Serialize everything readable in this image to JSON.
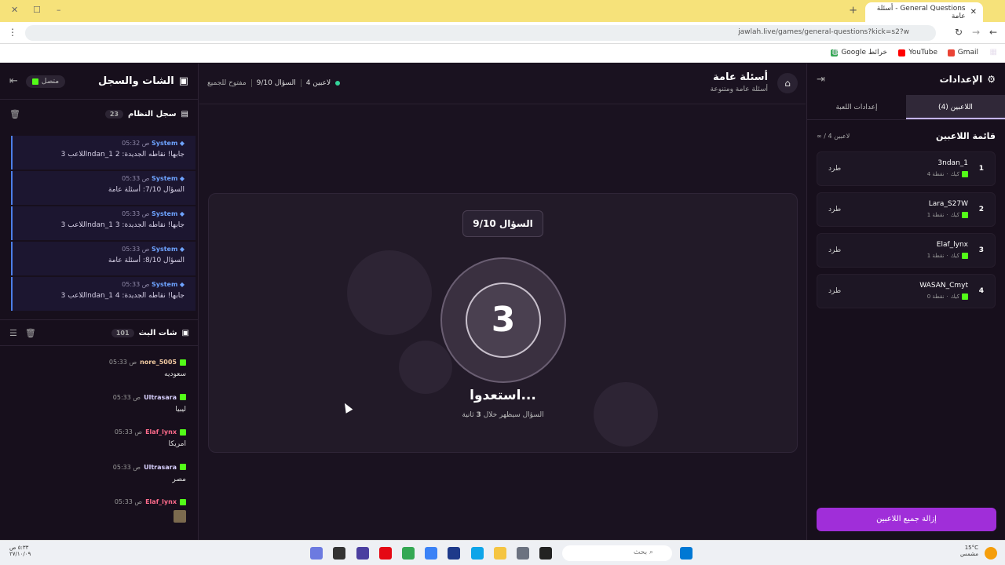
{
  "browser": {
    "tab_title": "General Questions - أسئلة عامة",
    "url": "jawlah.live/games/general-questions?kick=s2?w",
    "bookmarks": [
      "Gmail",
      "YouTube",
      "Google خرائط"
    ]
  },
  "chat_panel": {
    "title": "الشات والسجل",
    "online_label": "متصل",
    "system_log": {
      "title": "سجل النظام",
      "count": "23",
      "entries": [
        {
          "author": "System",
          "time": "05:32 ص",
          "msg": "اللاعب 3ndan_1 جابها! نقاطه الجديدة: 2"
        },
        {
          "author": "System",
          "time": "05:33 ص",
          "msg": "السؤال 7/10: أسئلة عامة"
        },
        {
          "author": "System",
          "time": "05:33 ص",
          "msg": "اللاعب 3ndan_1 جابها! نقاطه الجديدة: 3"
        },
        {
          "author": "System",
          "time": "05:33 ص",
          "msg": "السؤال 8/10: أسئلة عامة"
        },
        {
          "author": "System",
          "time": "05:33 ص",
          "msg": "اللاعب 3ndan_1 جابها! نقاطه الجديدة: 4"
        }
      ]
    },
    "stream_chat": {
      "title": "شات البث",
      "count": "101",
      "messages": [
        {
          "user": "nore_5005",
          "time": "05:33 ص",
          "text": "سعوديه",
          "color": "#f0c9a0"
        },
        {
          "user": "Ultrasara",
          "time": "05:33 ص",
          "text": "ليبيا",
          "color": "#d9d1ff"
        },
        {
          "user": "Elaf_lynx",
          "time": "05:33 ص",
          "text": "امريكا",
          "color": "#ff6b8b"
        },
        {
          "user": "Ultrasara",
          "time": "05:33 ص",
          "text": "مصر",
          "color": "#d9d1ff"
        },
        {
          "user": "Elaf_lynx",
          "time": "05:33 ص",
          "text": "",
          "color": "#ff6b8b"
        }
      ]
    }
  },
  "game": {
    "title": "أسئلة عامة",
    "subtitle": "أسئلة عامة ومتنوعة",
    "players_count_label": "4 لاعبين",
    "question_label": "السؤال 9/10",
    "open_label": "مفتوح للجميع",
    "question_pill": "السؤال 9/10",
    "countdown": "3",
    "ready_text": "استعدوا...",
    "ready_sub_pre": "السؤال سيظهر خلال",
    "ready_sub_num": "3",
    "ready_sub_post": "ثانية"
  },
  "settings_panel": {
    "title": "الإعدادات",
    "tabs": [
      "اللاعبين (4)",
      "إعدادات اللعبة"
    ],
    "players_header": "قائمة اللاعبين",
    "players_count": "∞ / 4 لاعبين",
    "kick_label": "طرد",
    "players": [
      {
        "rank": "1",
        "name": "3ndan_1",
        "platform": "كيك",
        "points": "4 نقطة"
      },
      {
        "rank": "2",
        "name": "Lara_S27W",
        "platform": "كيك",
        "points": "1 نقطة"
      },
      {
        "rank": "3",
        "name": "Elaf_lynx",
        "platform": "كيك",
        "points": "1 نقطة"
      },
      {
        "rank": "4",
        "name": "WASAN_Cmyt",
        "platform": "كيك",
        "points": "0 نقطة"
      }
    ],
    "remove_all_label": "إزالة جميع اللاعبين"
  },
  "taskbar": {
    "search_placeholder": "بحث",
    "weather_temp": "15°C",
    "weather_desc": "مشمس",
    "time": "٥:٣٣ ص",
    "date": "٢٧/١٠/٠٩"
  }
}
